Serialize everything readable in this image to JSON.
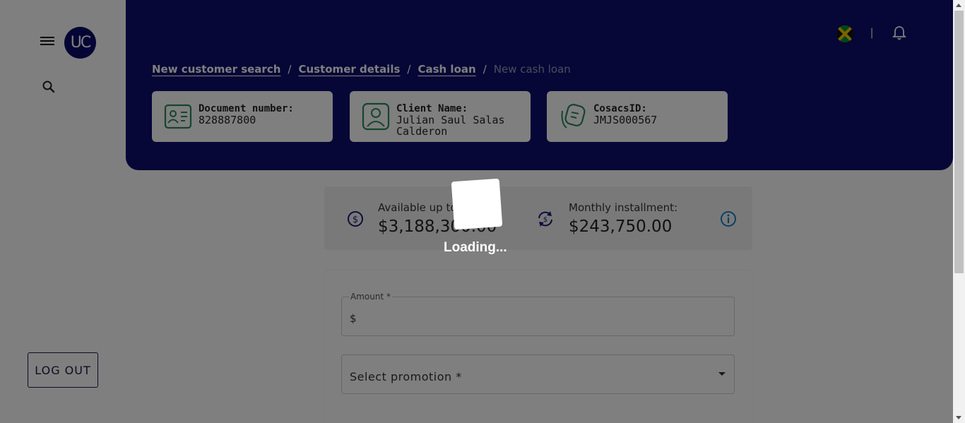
{
  "sidebar": {
    "logo_text": "UC",
    "logout_label": "LOG OUT"
  },
  "header": {
    "separator": "|",
    "breadcrumb": {
      "item1": "New customer search",
      "item2": "Customer details",
      "item3": "Cash loan",
      "current": "New cash loan",
      "sep": "/"
    },
    "cards": {
      "document": {
        "label": "Document number:",
        "value": "828887800"
      },
      "client": {
        "label": "Client Name:",
        "value": "Julian Saul Salas Calderon"
      },
      "cosacs": {
        "label": "CosacsID:",
        "value": "JMJS000567"
      }
    }
  },
  "summary": {
    "available_label": "Available up to:",
    "available_value": "$3,188,300.00",
    "monthly_label": "Monthly installment:",
    "monthly_value": "$243,750.00"
  },
  "form": {
    "amount_label": "Amount *",
    "amount_prefix": "$",
    "promotion_placeholder": "Select promotion *"
  },
  "overlay": {
    "loading_text": "Loading..."
  },
  "colors": {
    "header_bg": "#0c0c6e",
    "accent_icon": "#2a8a5a",
    "info_icon": "#1a7fc0"
  }
}
